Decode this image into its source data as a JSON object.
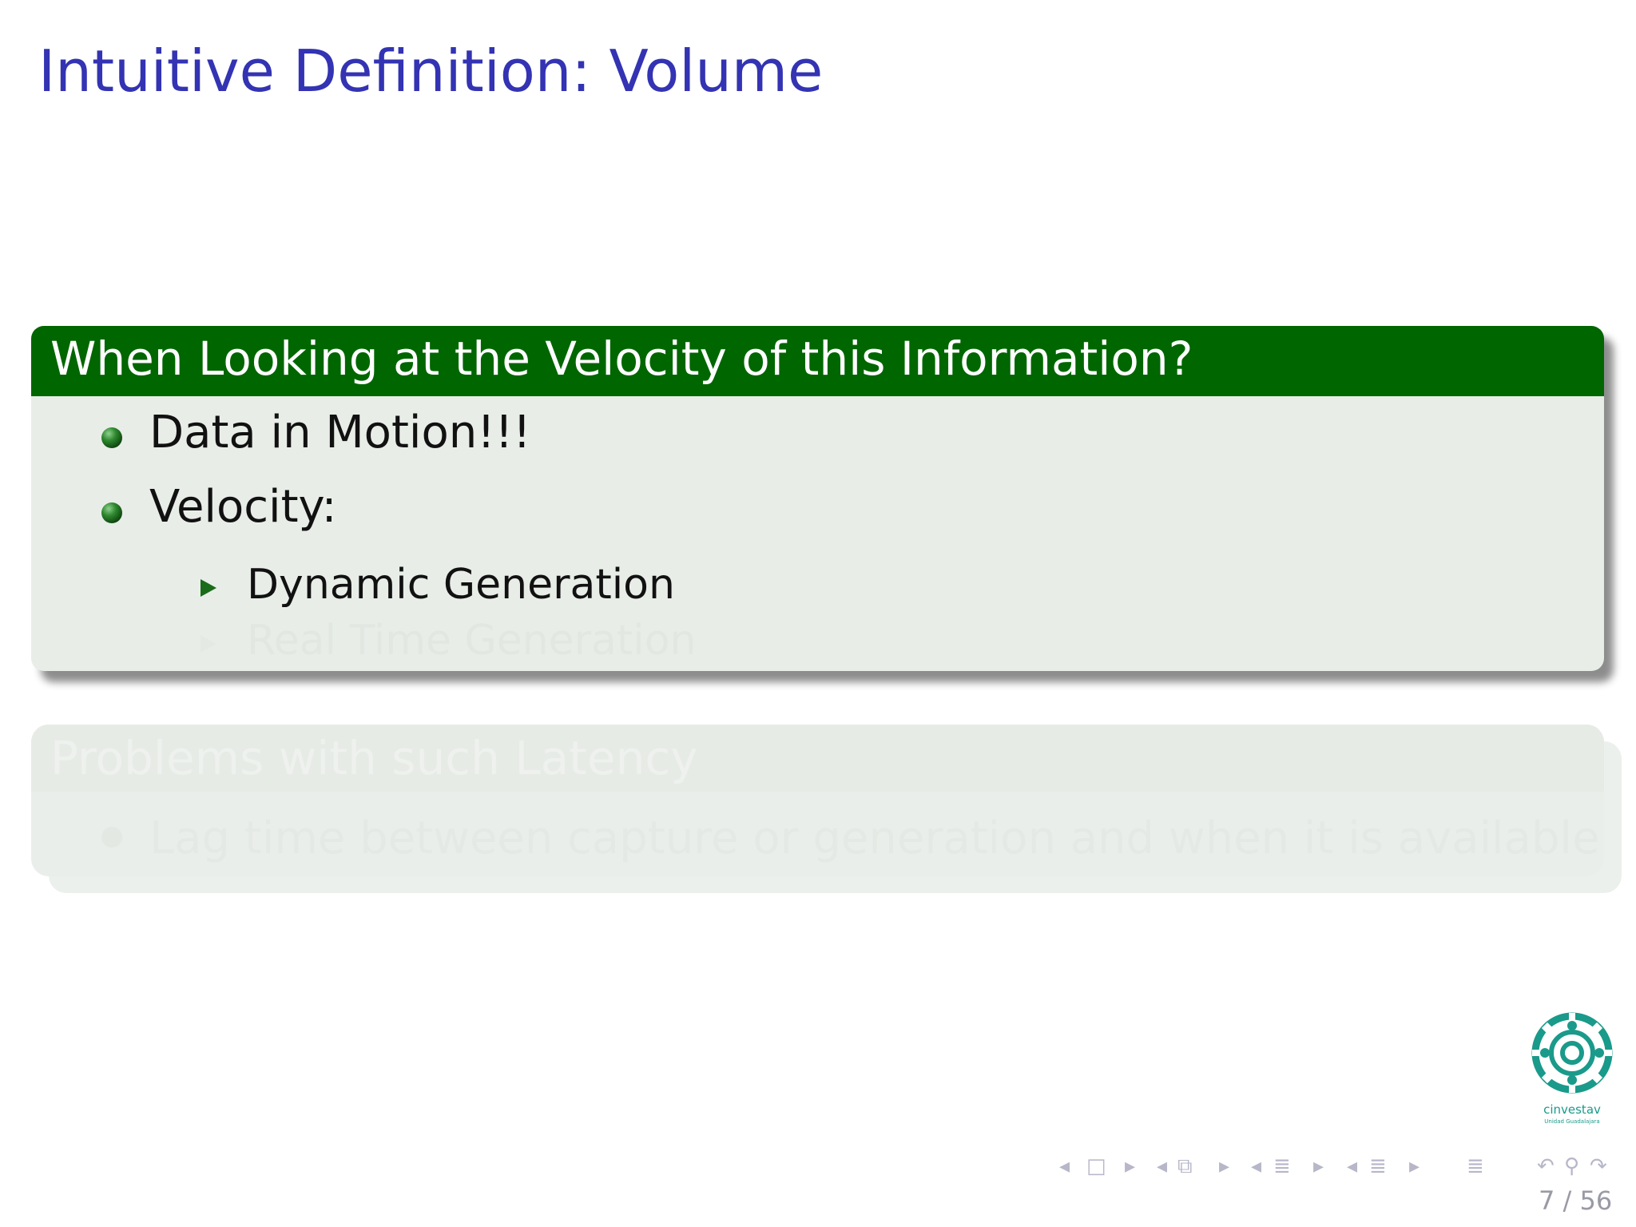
{
  "slide": {
    "title": "Intuitive Definition: Volume",
    "page_current": "7",
    "page_separator": "/",
    "page_total": "56"
  },
  "block_velocity": {
    "heading": "When Looking at the Velocity of this Information?",
    "items": [
      {
        "label": "Data in Motion!!!"
      },
      {
        "label": "Velocity:",
        "subitems": [
          {
            "label": "Dynamic Generation",
            "faded": false
          },
          {
            "label": "Real Time Generation",
            "faded": true
          }
        ]
      }
    ]
  },
  "block_latency": {
    "heading": "Problems with such Latency",
    "items": [
      {
        "label": "Lag time between capture or generation and when it is available!!!"
      }
    ],
    "faded": true
  },
  "logo": {
    "text": "cinvestav",
    "subtext": "Unidad Guadalajara",
    "color": "#1a9a8a"
  },
  "colors": {
    "title": "#3333b3",
    "block_header": "#006600",
    "block_body": "#e8ede8"
  },
  "navigation": {
    "icons": [
      "nav-prev-frame-icon",
      "nav-frame-icon",
      "nav-next-frame-icon",
      "nav-prev-section-icon",
      "nav-section-icon",
      "nav-next-section-icon",
      "nav-prev-subsection-icon",
      "nav-subsection-icon",
      "nav-next-subsection-icon",
      "nav-doc-prev-icon",
      "nav-doc-icon",
      "nav-doc-next-icon",
      "nav-toc-icon",
      "nav-back-icon",
      "nav-search-icon",
      "nav-forward-icon"
    ]
  }
}
